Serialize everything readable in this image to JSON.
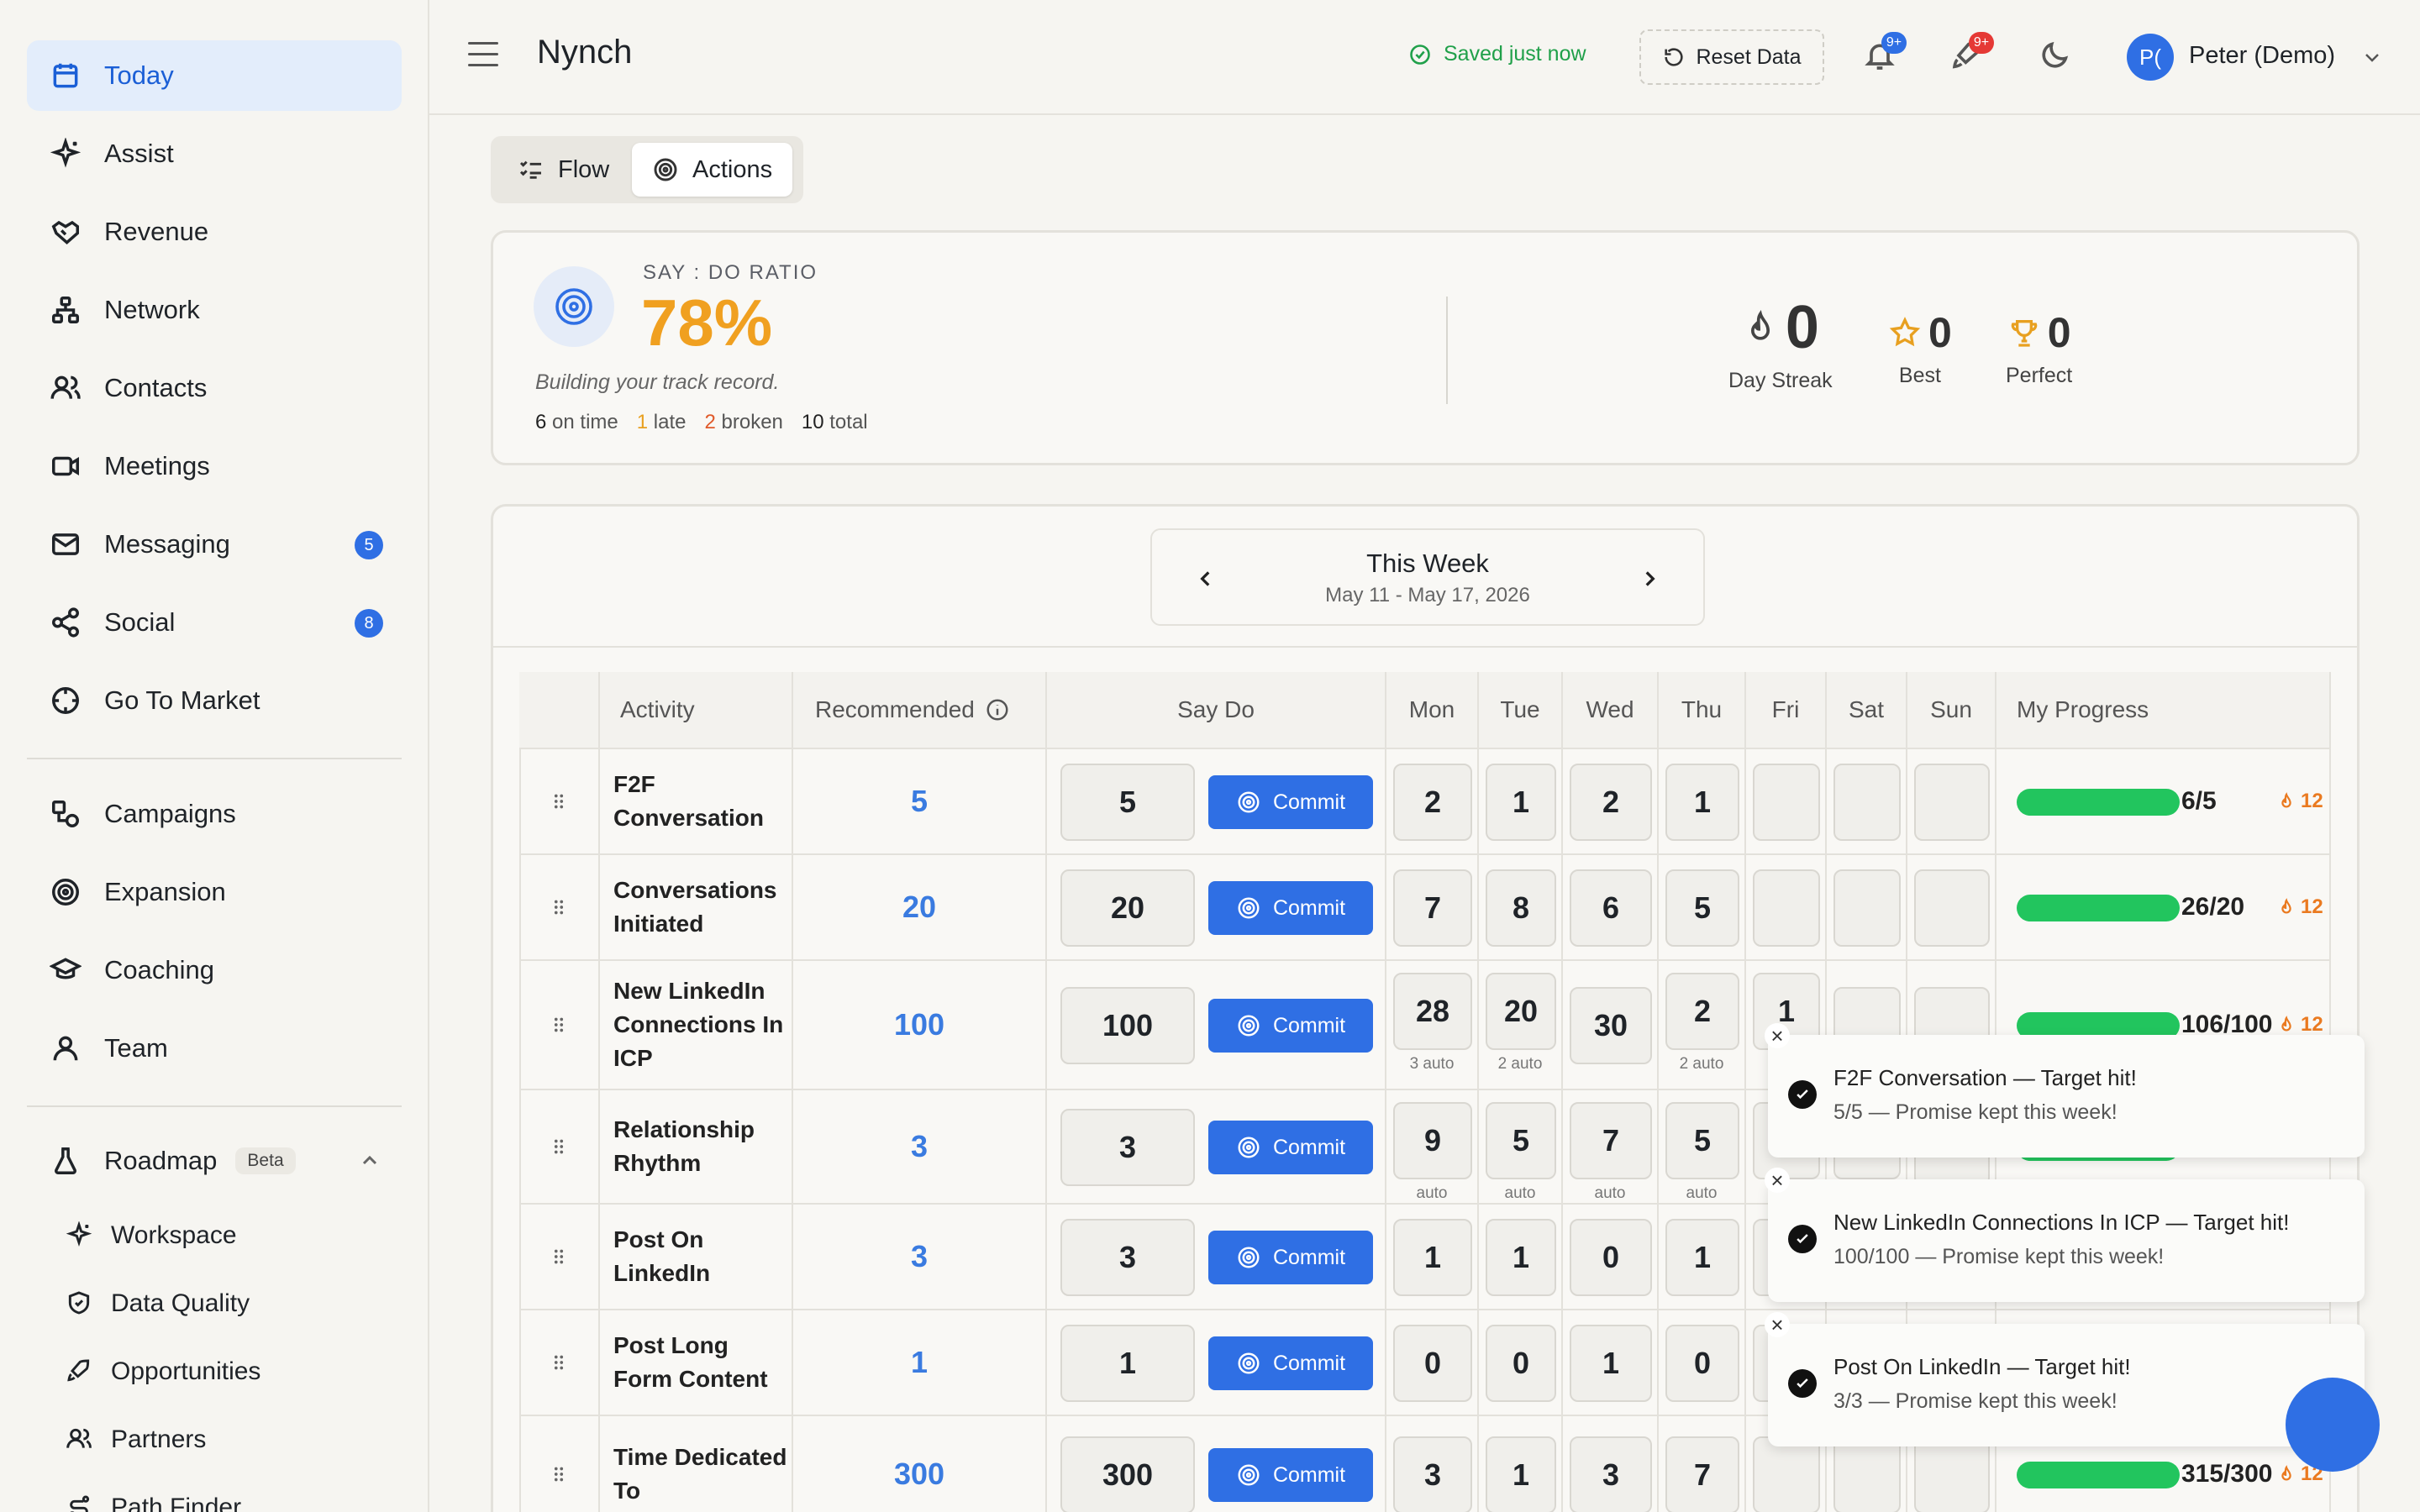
{
  "app": {
    "title": "Nynch"
  },
  "sidebar": {
    "items": [
      {
        "label": "Today",
        "icon": "calendar-icon",
        "active": true
      },
      {
        "label": "Assist",
        "icon": "sparkle-icon"
      },
      {
        "label": "Revenue",
        "icon": "handshake-icon"
      },
      {
        "label": "Network",
        "icon": "network-icon"
      },
      {
        "label": "Contacts",
        "icon": "users-icon"
      },
      {
        "label": "Meetings",
        "icon": "video-icon"
      },
      {
        "label": "Messaging",
        "icon": "mail-icon",
        "badge": "5"
      },
      {
        "label": "Social",
        "icon": "share-icon",
        "badge": "8"
      },
      {
        "label": "Go To Market",
        "icon": "crosshair-icon"
      }
    ],
    "items2": [
      {
        "label": "Campaigns",
        "icon": "shapes-icon"
      },
      {
        "label": "Expansion",
        "icon": "target-icon"
      },
      {
        "label": "Coaching",
        "icon": "graduation-cap-icon"
      },
      {
        "label": "Team",
        "icon": "user-icon"
      }
    ],
    "roadmap": {
      "label": "Roadmap",
      "badge": "Beta"
    },
    "sub_items": [
      {
        "label": "Workspace",
        "icon": "sparkle-icon"
      },
      {
        "label": "Data Quality",
        "icon": "shield-icon"
      },
      {
        "label": "Opportunities",
        "icon": "rocket-icon"
      },
      {
        "label": "Partners",
        "icon": "users-icon"
      },
      {
        "label": "Path Finder",
        "icon": "route-icon"
      }
    ]
  },
  "header": {
    "saved": "Saved just now",
    "reset": "Reset Data",
    "notif_badge": "9+",
    "rocket_badge": "9+",
    "avatar": "P(",
    "user": "Peter (Demo)"
  },
  "tabs": [
    {
      "label": "Flow",
      "icon": "list-check-icon"
    },
    {
      "label": "Actions",
      "icon": "target-icon",
      "active": true
    }
  ],
  "ratio": {
    "label": "SAY : DO RATIO",
    "value": "78%",
    "subtitle": "Building your track record.",
    "on_time": "6",
    "on_time_label": "on time",
    "late": "1",
    "late_label": "late",
    "broken": "2",
    "broken_label": "broken",
    "total": "10",
    "total_label": "total",
    "streak": {
      "value": "0",
      "label": "Day Streak"
    },
    "best": {
      "value": "0",
      "label": "Best"
    },
    "perfect": {
      "value": "0",
      "label": "Perfect"
    }
  },
  "week": {
    "title": "This Week",
    "range": "May 11 - May 17, 2026"
  },
  "table": {
    "headers": {
      "activity": "Activity",
      "recommended": "Recommended",
      "say_do": "Say Do",
      "mon": "Mon",
      "tue": "Tue",
      "wed": "Wed",
      "thu": "Thu",
      "fri": "Fri",
      "sat": "Sat",
      "sun": "Sun",
      "progress": "My Progress"
    },
    "commit_label": "Commit",
    "auto_label": "auto",
    "rows": [
      {
        "name": "F2F Conversation",
        "rec": "5",
        "say": "5",
        "days": [
          "2",
          "1",
          "2",
          "1",
          "",
          "",
          ""
        ],
        "auto": [],
        "progress": "6/5",
        "fill": 1.0,
        "streak": "12"
      },
      {
        "name": "Conversations Initiated",
        "rec": "20",
        "say": "20",
        "days": [
          "7",
          "8",
          "6",
          "5",
          "",
          "",
          ""
        ],
        "auto": [],
        "progress": "26/20",
        "fill": 1.0,
        "streak": "12"
      },
      {
        "name": "New LinkedIn Connections In ICP",
        "rec": "100",
        "say": "100",
        "days": [
          "28",
          "20",
          "30",
          "2",
          "1",
          "",
          ""
        ],
        "auto": [
          "3 auto",
          "2 auto",
          "",
          "2 auto",
          "1"
        ],
        "progress": "106/100",
        "fill": 1.0,
        "streak": "12"
      },
      {
        "name": "Relationship Rhythm",
        "rec": "3",
        "say": "3",
        "days": [
          "9",
          "5",
          "7",
          "5",
          "",
          "",
          ""
        ],
        "auto": [
          "auto",
          "auto",
          "auto",
          "auto",
          "auto",
          "auto",
          ""
        ],
        "progress": "",
        "fill": 1.0,
        "streak": ""
      },
      {
        "name": "Post On LinkedIn",
        "rec": "3",
        "say": "3",
        "days": [
          "1",
          "1",
          "0",
          "1",
          "",
          "",
          ""
        ],
        "auto": [],
        "progress": "",
        "fill": 0,
        "streak": ""
      },
      {
        "name": "Post Long Form Content",
        "rec": "1",
        "say": "1",
        "days": [
          "0",
          "0",
          "1",
          "0",
          "",
          "",
          ""
        ],
        "auto": [],
        "progress": "",
        "fill": 0,
        "streak": ""
      },
      {
        "name": "Time Dedicated To",
        "rec": "300",
        "say": "300",
        "days": [
          "3",
          "1",
          "3",
          "7",
          "",
          "",
          ""
        ],
        "auto": [],
        "progress": "315/300",
        "fill": 1.0,
        "streak": "12"
      }
    ]
  },
  "toasts": [
    {
      "title": "F2F Conversation — Target hit!",
      "sub": "5/5 — Promise kept this week!"
    },
    {
      "title": "New LinkedIn Connections In ICP — Target hit!",
      "sub": "100/100 — Promise kept this week!"
    },
    {
      "title": "Post On LinkedIn — Target hit!",
      "sub": "3/3 — Promise kept this week!"
    }
  ],
  "colors": {
    "accent": "#2f6fe4",
    "ratio": "#f0a020",
    "progress": "#22c55e",
    "streak": "#ea7a20",
    "late": "#e8a020",
    "broken": "#e05a2a"
  }
}
